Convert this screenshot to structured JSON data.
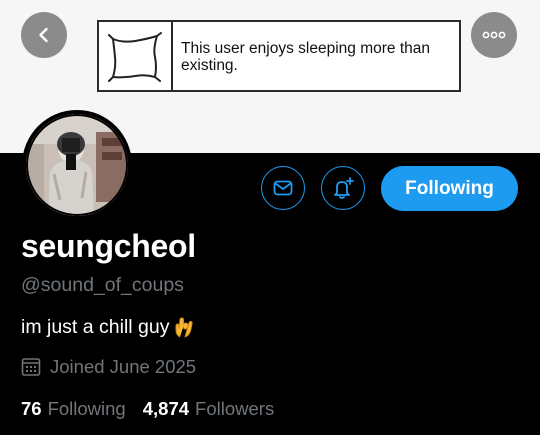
{
  "banner": {
    "box_text": "This user enjoys sleeping more than existing."
  },
  "nav": {
    "back_icon": "chevron-left-icon",
    "more_icon": "more-horizontal-icon"
  },
  "actions": {
    "message_icon": "envelope-icon",
    "notify_icon": "bell-plus-icon",
    "follow_label": "Following"
  },
  "profile": {
    "display_name": "seungcheol",
    "handle": "@sound_of_coups",
    "bio": "im just a chill guy",
    "bio_emoji": "ok-hand-emoji",
    "joined": "Joined June 2025",
    "following_count": "76",
    "following_label": "Following",
    "followers_count": "4,874",
    "followers_label": "Followers"
  },
  "colors": {
    "accent": "#1d9bf0",
    "background": "#000000",
    "secondary_text": "#71767b",
    "banner": "#f6f6f6"
  }
}
